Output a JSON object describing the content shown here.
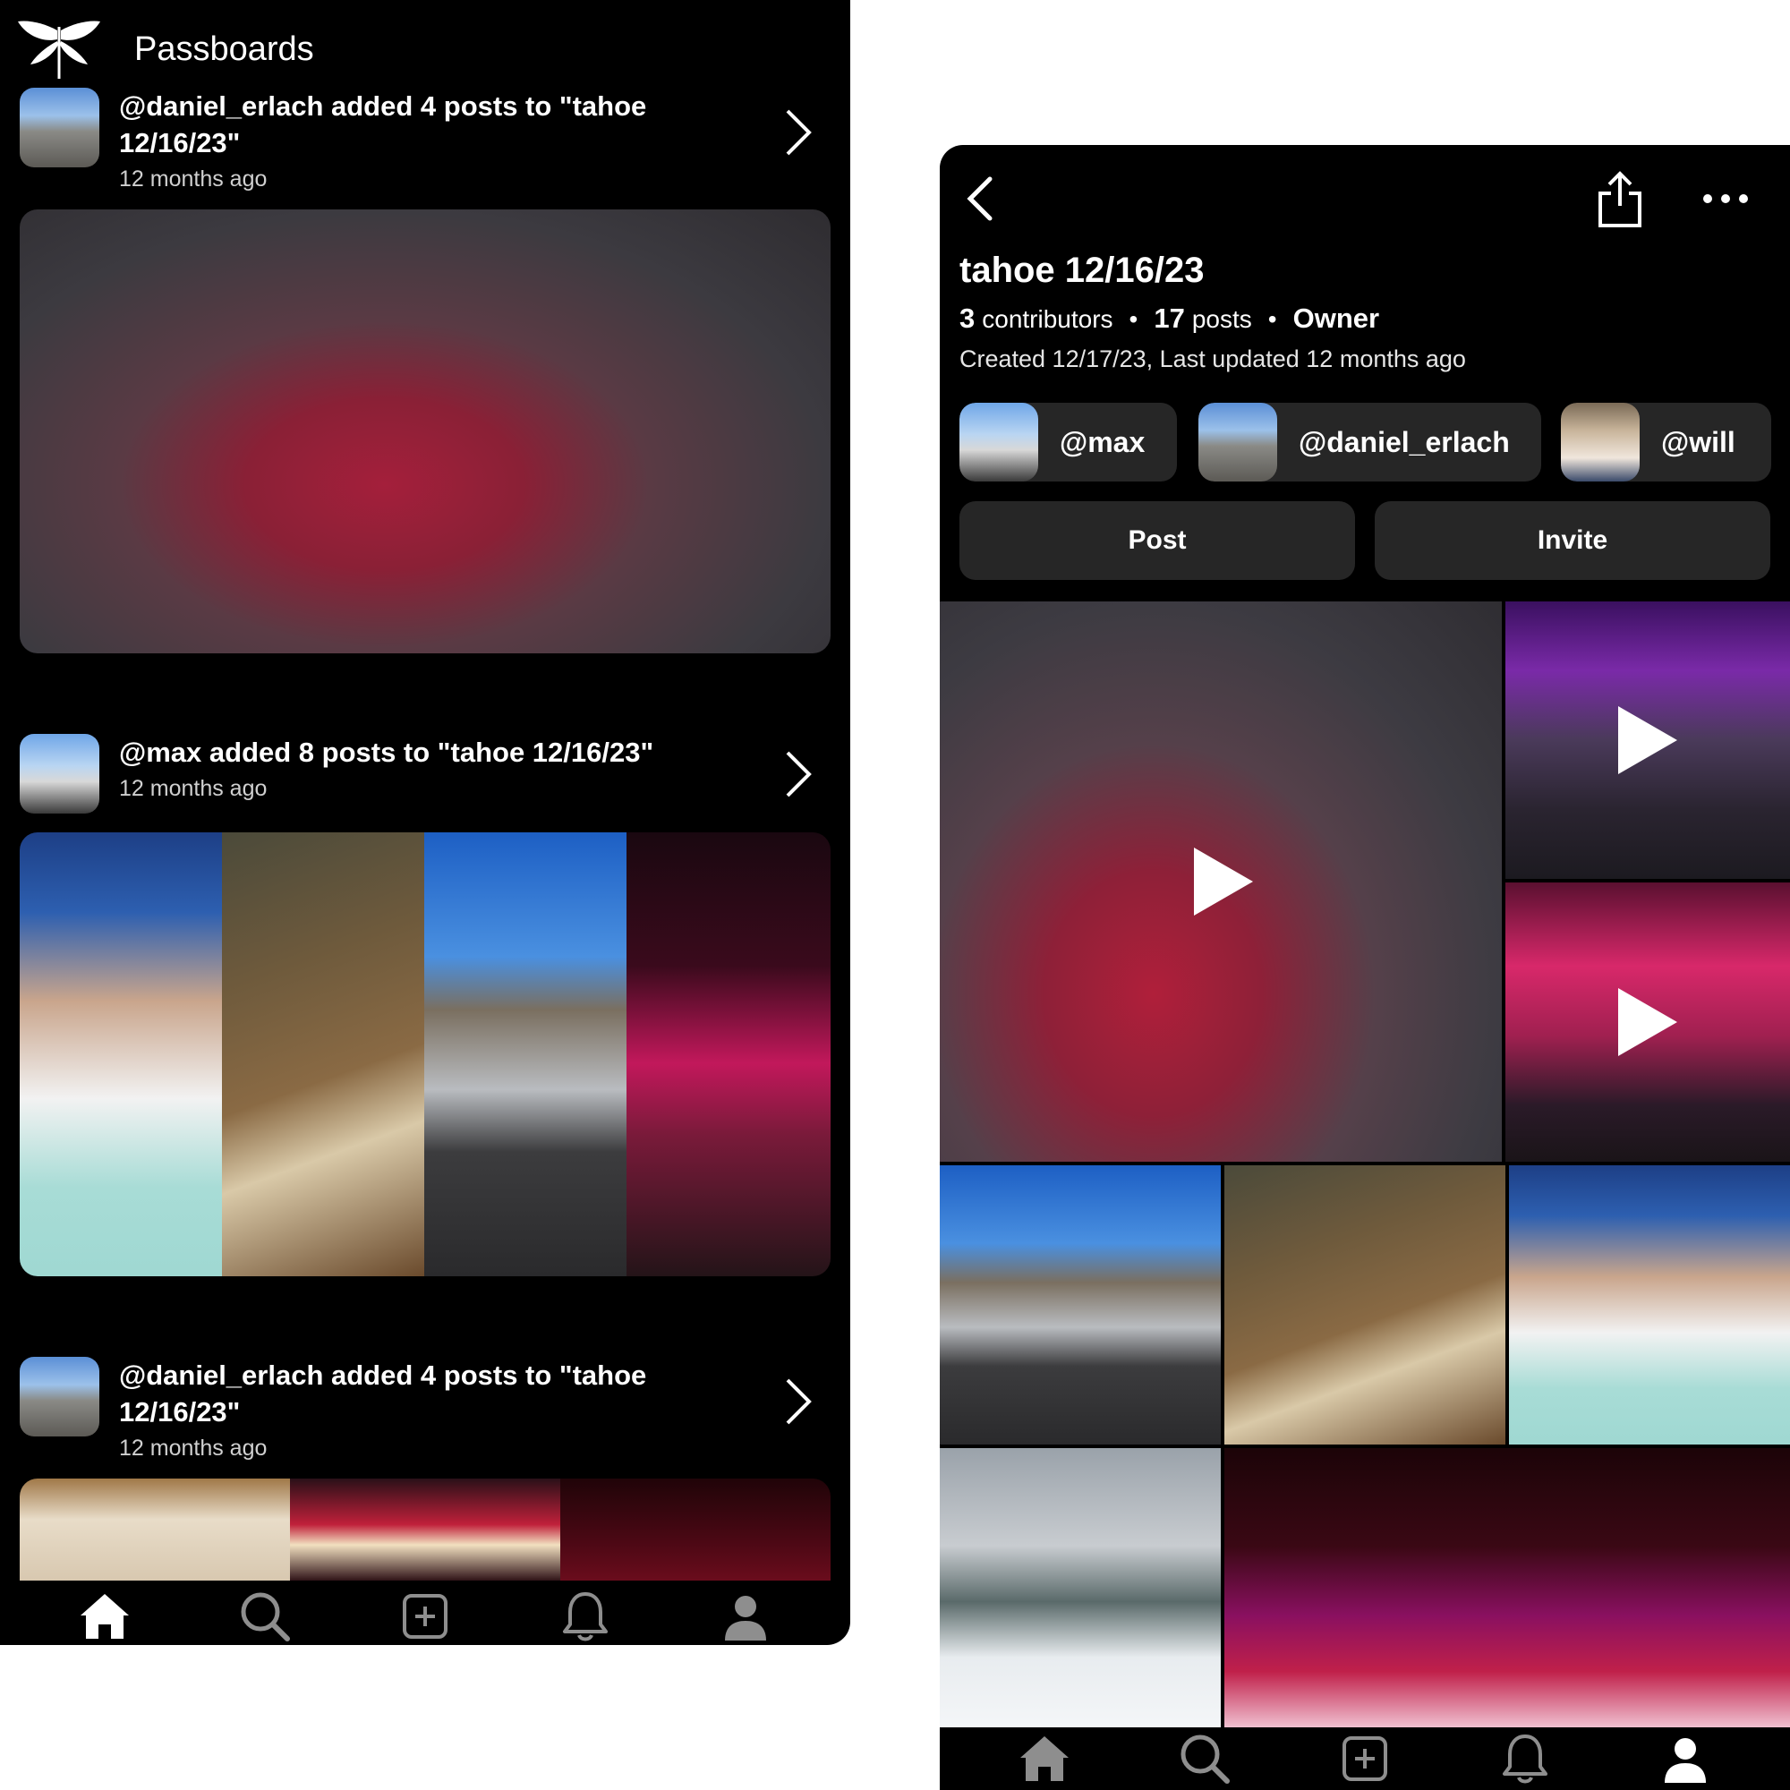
{
  "feed": {
    "app_name": "Passboards",
    "activities": [
      {
        "message": "@daniel_erlach added 4 posts to \"tahoe 12/16/23\"",
        "time": "12 months ago"
      },
      {
        "message": "@max added 8 posts to \"tahoe 12/16/23\"",
        "time": "12 months ago"
      },
      {
        "message": "@daniel_erlach added 4 posts to \"tahoe 12/16/23\"",
        "time": "12 months ago"
      }
    ]
  },
  "tabs": [
    "home-icon",
    "search-icon",
    "add-post-icon",
    "notifications-icon",
    "profile-icon"
  ],
  "board": {
    "title": "tahoe 12/16/23",
    "contributors_count": "3",
    "contributors_label": "contributors",
    "posts_count": "17",
    "posts_label": "posts",
    "separator": "•",
    "role": "Owner",
    "created": "Created 12/17/23, Last updated 12 months ago",
    "contributors": [
      "@max",
      "@daniel_erlach",
      "@will"
    ],
    "post_label": "Post",
    "invite_label": "Invite"
  },
  "colors": {
    "background": "#000000",
    "chip": "#262626",
    "muted_text": "#d0d0d0"
  }
}
